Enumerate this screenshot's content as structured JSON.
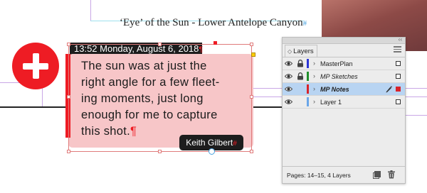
{
  "document": {
    "title": "‘Eye’ of the Sun - Lower Antelope Canyon",
    "title_mark": "#",
    "date_line": "13:52 Monday, August 6, 2018",
    "body_text_lines": [
      "The sun was at just the",
      "right angle for a few fleet-",
      "ing moments, just long",
      "enough for me to capture",
      "this shot."
    ],
    "author": "Keith Gilbert",
    "pilcrow": "¶",
    "end_mark": "#"
  },
  "layers_panel": {
    "tab_label": "Layers",
    "collapse_glyph": "‹‹",
    "layers": [
      {
        "name": "MasterPlan",
        "color": "#2b35d6",
        "locked": true,
        "selected": false,
        "style": "normal"
      },
      {
        "name": "MP Sketches",
        "color": "#1f8f2a",
        "locked": true,
        "selected": false,
        "style": "italic"
      },
      {
        "name": "MP Notes",
        "color": "#d8232a",
        "locked": false,
        "selected": true,
        "style": "bold"
      },
      {
        "name": "Layer 1",
        "color": "#6aa6e8",
        "locked": false,
        "selected": false,
        "style": "normal"
      }
    ],
    "footer_text": "Pages: 14–15, 4 Layers"
  },
  "icons": {
    "red_circle": "plus-icon",
    "eye": "eye-icon",
    "lock": "lock-icon",
    "pen": "pen-icon",
    "new_layer": "new-layer-icon",
    "trash": "trash-icon",
    "panel_menu": "menu-icon"
  },
  "colors": {
    "accent_red": "#ee1c24",
    "note_fill": "#f7c6c8",
    "selection_blue": "#b8d4f2"
  }
}
